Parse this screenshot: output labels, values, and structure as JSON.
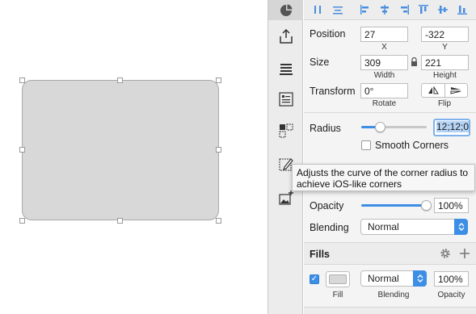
{
  "canvas": {
    "shape_fill": "#d8d8d8",
    "shape_border": "#a9a9a9"
  },
  "toolbar": {
    "top_icon": "pie-chart-icon",
    "buttons": [
      "export-icon",
      "layers-stack-icon",
      "list-panel-icon",
      "components-icon",
      "edit-path-icon",
      "add-image-icon"
    ]
  },
  "align_bar": {
    "icons": [
      "distribute-horizontal-icon",
      "distribute-vertical-icon",
      "align-left-icon",
      "align-center-horizontal-icon",
      "align-right-icon",
      "align-top-icon",
      "align-middle-vertical-icon",
      "align-bottom-icon"
    ]
  },
  "position": {
    "label": "Position",
    "x_value": "27",
    "y_value": "-322",
    "x_label": "X",
    "y_label": "Y"
  },
  "size": {
    "label": "Size",
    "width_value": "309",
    "height_value": "221",
    "width_label": "Width",
    "height_label": "Height",
    "lock_icon": "lock-icon"
  },
  "transform": {
    "label": "Transform",
    "rotate_value": "0°",
    "rotate_label": "Rotate",
    "flip_label": "Flip"
  },
  "radius": {
    "label": "Radius",
    "value": "12;12;0",
    "slider_level": 0.3,
    "smooth_corners_label": "Smooth Corners",
    "smooth_corners_checked": false
  },
  "tooltip": {
    "text": "Adjusts the curve of the corner radius to achieve iOS-like corners"
  },
  "opacity": {
    "label": "Opacity",
    "value": "100%",
    "slider_level": 1.0
  },
  "blending": {
    "label": "Blending",
    "value": "Normal"
  },
  "fills": {
    "title": "Fills",
    "enabled": true,
    "fill_label": "Fill",
    "blend_value": "Normal",
    "blend_label": "Blending",
    "opacity_value": "100%",
    "opacity_label": "Opacity",
    "swatch_color": "#d8d8d8"
  },
  "colors": {
    "accent": "#3d8fe6",
    "focus_ring": "#7fb1ec"
  }
}
